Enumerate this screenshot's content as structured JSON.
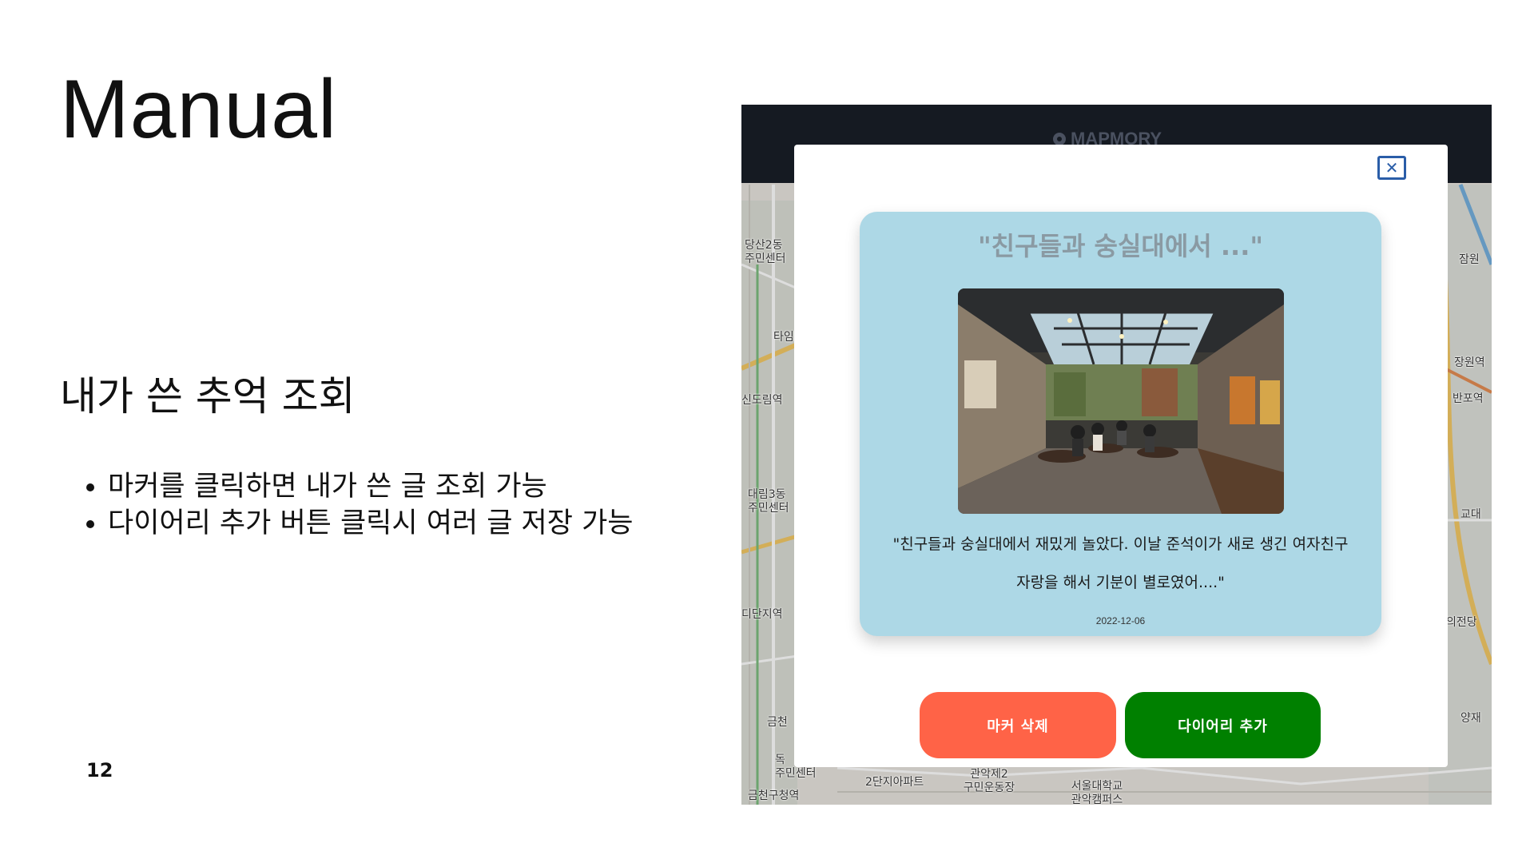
{
  "slide": {
    "title": "Manual",
    "section_heading": "내가 쓴 추억 조회",
    "bullets": [
      "마커를 클릭하면 내가 쓴 글 조회 가능",
      "다이어리 추가 버튼 클릭시 여러 글 저장 가능"
    ],
    "page_number": "12"
  },
  "app": {
    "brand": "MAPMORY"
  },
  "map": {
    "labels": [
      "당산2동\n주민센터",
      "타임",
      "신도림역",
      "대림3동\n주민센터",
      "디단지역",
      "금천",
      "독\n주민센터",
      "금천구청역",
      "2단지아파트",
      "관악제2\n구민운동장",
      "서울대학교\n관악캠퍼스",
      "잠원",
      "장원역",
      "반포역",
      "교대",
      "의전당",
      "양재"
    ]
  },
  "modal": {
    "close_icon": "close-icon",
    "card": {
      "title": "\"친구들과 숭실대에서 ...\"",
      "body": "\"친구들과 숭실대에서 재밌게 놀았다. 이날 준석이가 새로 생긴 여자친구 자랑을 해서 기분이 별로였어....\"",
      "date": "2022-12-06"
    },
    "buttons": {
      "delete_label": "마커 삭제",
      "add_label": "다이어리 추가"
    }
  },
  "colors": {
    "header_bg": "#151a22",
    "card_bg": "#add8e6",
    "delete_button": "#ff6347",
    "add_button": "#008000",
    "close_border": "#2a5da8"
  }
}
